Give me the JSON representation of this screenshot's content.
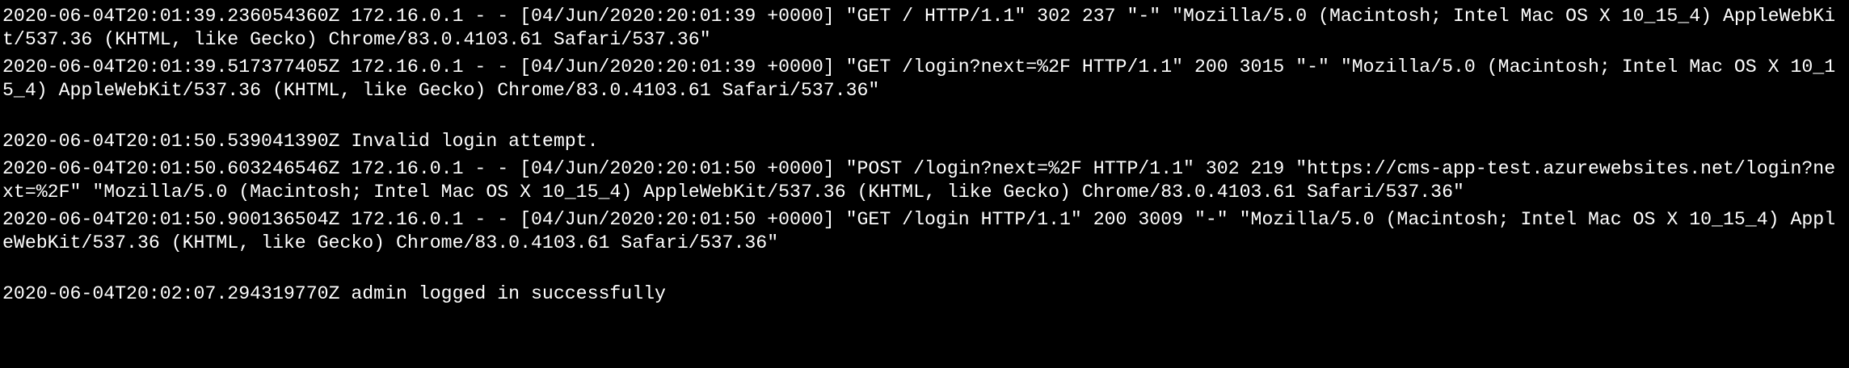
{
  "terminal": {
    "colors": {
      "background": "#000000",
      "foreground": "#ffffff"
    },
    "lines": [
      "2020-06-04T20:01:39.236054360Z 172.16.0.1 - - [04/Jun/2020:20:01:39 +0000] \"GET / HTTP/1.1\" 302 237 \"-\" \"Mozilla/5.0 (Macintosh; Intel Mac OS X 10_15_4) AppleWebKit/537.36 (KHTML, like Gecko) Chrome/83.0.4103.61 Safari/537.36\"",
      "2020-06-04T20:01:39.517377405Z 172.16.0.1 - - [04/Jun/2020:20:01:39 +0000] \"GET /login?next=%2F HTTP/1.1\" 200 3015 \"-\" \"Mozilla/5.0 (Macintosh; Intel Mac OS X 10_15_4) AppleWebKit/537.36 (KHTML, like Gecko) Chrome/83.0.4103.61 Safari/537.36\"",
      "2020-06-04T20:01:50.539041390Z Invalid login attempt.",
      "2020-06-04T20:01:50.603246546Z 172.16.0.1 - - [04/Jun/2020:20:01:50 +0000] \"POST /login?next=%2F HTTP/1.1\" 302 219 \"https://cms-app-test.azurewebsites.net/login?next=%2F\" \"Mozilla/5.0 (Macintosh; Intel Mac OS X 10_15_4) AppleWebKit/537.36 (KHTML, like Gecko) Chrome/83.0.4103.61 Safari/537.36\"",
      "2020-06-04T20:01:50.900136504Z 172.16.0.1 - - [04/Jun/2020:20:01:50 +0000] \"GET /login HTTP/1.1\" 200 3009 \"-\" \"Mozilla/5.0 (Macintosh; Intel Mac OS X 10_15_4) AppleWebKit/537.36 (KHTML, like Gecko) Chrome/83.0.4103.61 Safari/537.36\"",
      "2020-06-04T20:02:07.294319770Z admin logged in successfully"
    ]
  }
}
